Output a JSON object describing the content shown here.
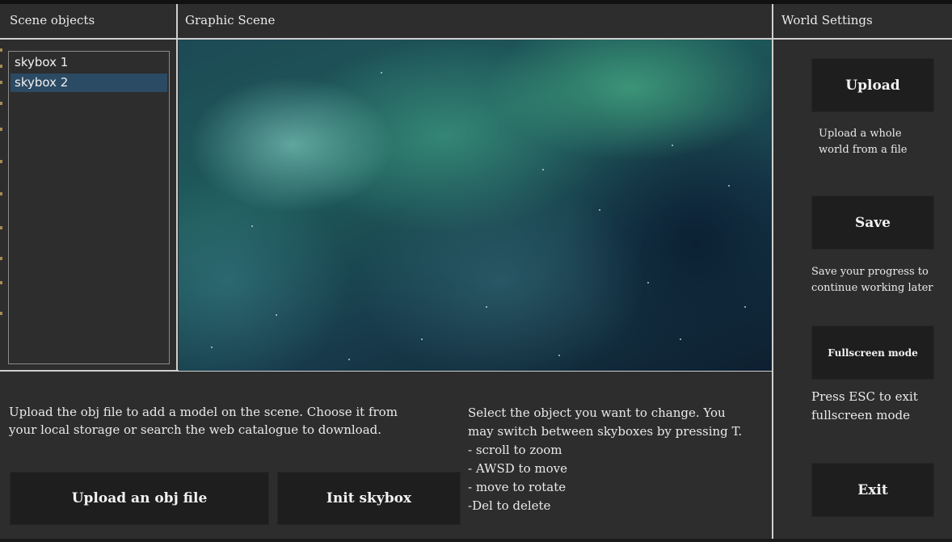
{
  "panels": {
    "scene_objects_title": "Scene objects",
    "graphic_scene_title": "Graphic Scene",
    "world_settings_title": "World Settings"
  },
  "scene_objects": {
    "items": [
      {
        "label": "skybox 1",
        "selected": false
      },
      {
        "label": "skybox 2",
        "selected": true
      }
    ]
  },
  "upload_section": {
    "description_lines": [
      "Upload the obj file to add a model on the scene. Choose it from",
      "your local storage or search the web catalogue to download."
    ],
    "upload_button_label": "Upload an obj file",
    "init_skybox_button_label": "Init skybox"
  },
  "instructions": {
    "lines": [
      "Select the object you want to change. You",
      "may switch between skyboxes by pressing T.",
      "- scroll to zoom",
      "- AWSD to move",
      "- move to rotate",
      "-Del to delete"
    ]
  },
  "world_settings": {
    "upload_label": "Upload",
    "upload_desc_lines": [
      "Upload a whole",
      "world from a file"
    ],
    "save_label": "Save",
    "save_desc_lines": [
      "Save your progress to",
      "continue working later"
    ],
    "fullscreen_label": "Fullscreen mode",
    "fullscreen_desc_lines": [
      "Press ESC to exit",
      "fullscreen mode"
    ],
    "exit_label": "Exit"
  },
  "colors": {
    "background": "#2d2d2d",
    "button": "#1e1e1e",
    "selection": "#2b4a63",
    "divider": "#cfcfcf"
  }
}
